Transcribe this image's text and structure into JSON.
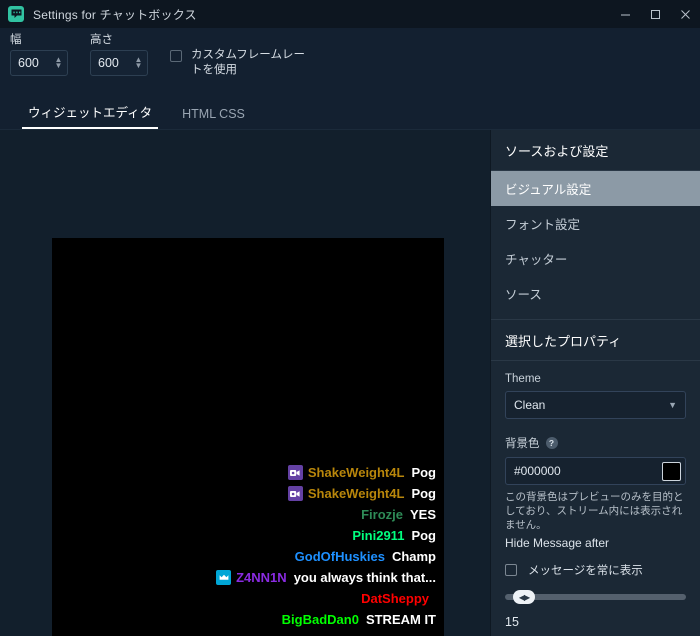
{
  "window": {
    "title": "Settings for チャットボックス",
    "icon": "chat-bubble-icon",
    "minimize": "−",
    "maximize": "□",
    "close": "✕"
  },
  "toolbar": {
    "width": {
      "label": "幅",
      "value": "600"
    },
    "height": {
      "label": "高さ",
      "value": "600"
    },
    "custom_framerate": {
      "label": "カスタムフレームレートを使用",
      "checked": false
    }
  },
  "tabs": [
    {
      "label": "ウィジェットエディタ",
      "active": true
    },
    {
      "label": "HTML CSS",
      "active": false
    }
  ],
  "preview": {
    "background": "#000000",
    "messages": [
      {
        "badge": "broadcaster",
        "name": "ShakeWeight4L",
        "color": "#b8860b",
        "text": "Pog"
      },
      {
        "badge": "broadcaster",
        "name": "ShakeWeight4L",
        "color": "#b8860b",
        "text": "Pog"
      },
      {
        "badge": "",
        "name": "Firozje",
        "color": "#2e8b57",
        "text": "YES"
      },
      {
        "badge": "",
        "name": "Pini2911",
        "color": "#00ff7f",
        "text": "Pog"
      },
      {
        "badge": "",
        "name": "GodOfHuskies",
        "color": "#1e90ff",
        "text": "Champ"
      },
      {
        "badge": "prime",
        "name": "Z4NN1N",
        "color": "#8a2be2",
        "text": "you always think that..."
      },
      {
        "badge": "",
        "name": "DatSheppy",
        "color": "#ff0000",
        "text": ""
      },
      {
        "badge": "",
        "name": "BigBadDan0",
        "color": "#00ff00",
        "text": "STREAM IT"
      }
    ]
  },
  "sidebar": {
    "header": "ソースおよび設定",
    "items": [
      {
        "label": "ビジュアル設定",
        "selected": true
      },
      {
        "label": "フォント設定",
        "selected": false
      },
      {
        "label": "チャッター",
        "selected": false
      },
      {
        "label": "ソース",
        "selected": false
      }
    ],
    "properties": {
      "header": "選択したプロパティ",
      "theme_label": "Theme",
      "theme_value": "Clean",
      "theme_chevron": "⌄",
      "bgcolor_label": "背景色",
      "help_glyph": "?",
      "bgcolor_value": "#000000",
      "bgcolor_swatch": "#000000",
      "hint": "この背景色はプレビューのみを目的としており、ストリーム内には表示されません。",
      "hide_after_label": "Hide Message after",
      "always_show_label": "メッセージを常に表示",
      "always_show_checked": false,
      "slider_value": "15",
      "slider_thumb_glyph": "◀▶"
    }
  }
}
